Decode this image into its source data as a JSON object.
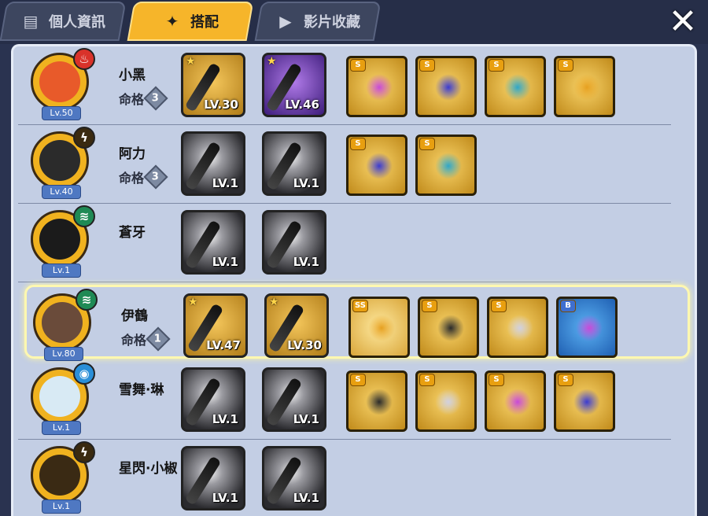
{
  "tabs": [
    {
      "label": "個人資訊",
      "icon": "profile-card-icon",
      "active": false
    },
    {
      "label": "搭配",
      "icon": "shuriken-icon",
      "active": true
    },
    {
      "label": "影片收藏",
      "icon": "play-icon",
      "active": false
    }
  ],
  "close_glyph": "✕",
  "fate_label": "命格",
  "rows": [
    {
      "name": "小黑",
      "level": "Lv.50",
      "element": "fire",
      "fate": "3",
      "weapons": [
        {
          "level": "LV.30",
          "star": true,
          "style": "gold"
        },
        {
          "level": "LV.46",
          "star": true,
          "style": "purple"
        }
      ],
      "cards": [
        {
          "rank": "S"
        },
        {
          "rank": "S"
        },
        {
          "rank": "S"
        },
        {
          "rank": "S"
        }
      ]
    },
    {
      "name": "阿力",
      "level": "Lv.40",
      "element": "lightning",
      "fate": "3",
      "weapons": [
        {
          "level": "LV.1",
          "star": false,
          "style": "dark"
        },
        {
          "level": "LV.1",
          "star": false,
          "style": "dark"
        }
      ],
      "cards": [
        {
          "rank": "S"
        },
        {
          "rank": "S"
        }
      ]
    },
    {
      "name": "蒼牙",
      "level": "Lv.1",
      "element": "wind",
      "fate": "",
      "weapons": [
        {
          "level": "LV.1",
          "star": false,
          "style": "dark"
        },
        {
          "level": "LV.1",
          "star": false,
          "style": "dark"
        }
      ],
      "cards": []
    },
    {
      "name": "伊鶴",
      "level": "Lv.80",
      "element": "wind",
      "fate": "1",
      "selected": true,
      "weapons": [
        {
          "level": "LV.47",
          "star": true,
          "style": "gold"
        },
        {
          "level": "LV.30",
          "star": true,
          "style": "gold"
        }
      ],
      "cards": [
        {
          "rank": "SS"
        },
        {
          "rank": "S"
        },
        {
          "rank": "S"
        },
        {
          "rank": "B"
        }
      ]
    },
    {
      "name": "雪舞·琳",
      "level": "Lv.1",
      "element": "water",
      "fate": "",
      "weapons": [
        {
          "level": "LV.1",
          "star": false,
          "style": "dark"
        },
        {
          "level": "LV.1",
          "star": false,
          "style": "dark"
        }
      ],
      "cards": [
        {
          "rank": "S"
        },
        {
          "rank": "S"
        },
        {
          "rank": "S"
        },
        {
          "rank": "S"
        }
      ]
    },
    {
      "name": "星閃·小椒",
      "level": "Lv.1",
      "element": "lightning",
      "fate": "",
      "weapons": [
        {
          "level": "LV.1",
          "star": false,
          "style": "dark"
        },
        {
          "level": "LV.1",
          "star": false,
          "style": "dark"
        }
      ],
      "cards": []
    }
  ],
  "colors": {
    "fire": "#d9322a",
    "lightning": "#3a2a10",
    "wind": "#1f8a55",
    "water": "#2a8fd8",
    "accent": "#f6b52a"
  }
}
